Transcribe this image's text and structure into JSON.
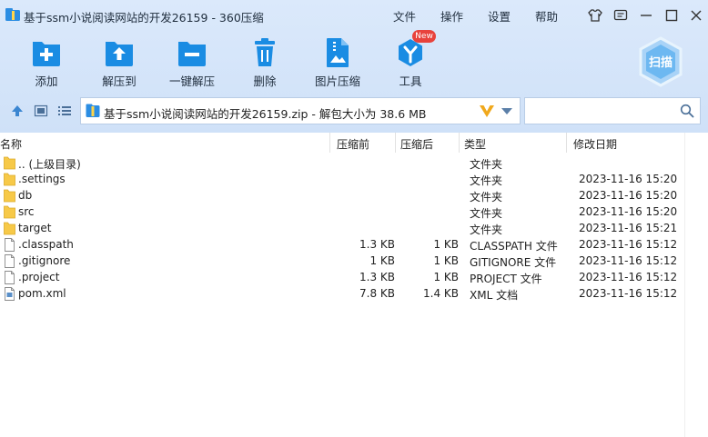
{
  "window": {
    "title": "基于ssm小说阅读网站的开发26159 - 360压缩",
    "menus": [
      "文件",
      "操作",
      "设置",
      "帮助"
    ]
  },
  "toolbar": {
    "items": [
      {
        "label": "添加",
        "icon": "add-icon"
      },
      {
        "label": "解压到",
        "icon": "extract-icon"
      },
      {
        "label": "一键解压",
        "icon": "one-click-extract-icon"
      },
      {
        "label": "删除",
        "icon": "trash-icon"
      },
      {
        "label": "图片压缩",
        "icon": "image-compress-icon"
      },
      {
        "label": "工具",
        "icon": "tools-icon"
      }
    ],
    "new_badge": "New",
    "scan_label": "扫描"
  },
  "address": {
    "path": "基于ssm小说阅读网站的开发26159.zip - 解包大小为 38.6 MB"
  },
  "search": {
    "placeholder": ""
  },
  "columns": {
    "name": "名称",
    "size": "压缩前",
    "packed": "压缩后",
    "type": "类型",
    "modified": "修改日期"
  },
  "files": [
    {
      "name": ".. (上级目录)",
      "size": "",
      "packed": "",
      "type": "文件夹",
      "modified": "",
      "icon": "folder-icon"
    },
    {
      "name": ".settings",
      "size": "",
      "packed": "",
      "type": "文件夹",
      "modified": "2023-11-16 15:20",
      "icon": "folder-icon"
    },
    {
      "name": "db",
      "size": "",
      "packed": "",
      "type": "文件夹",
      "modified": "2023-11-16 15:20",
      "icon": "folder-icon"
    },
    {
      "name": "src",
      "size": "",
      "packed": "",
      "type": "文件夹",
      "modified": "2023-11-16 15:20",
      "icon": "folder-icon"
    },
    {
      "name": "target",
      "size": "",
      "packed": "",
      "type": "文件夹",
      "modified": "2023-11-16 15:21",
      "icon": "folder-icon"
    },
    {
      "name": ".classpath",
      "size": "1.3 KB",
      "packed": "1 KB",
      "type": "CLASSPATH 文件",
      "modified": "2023-11-16 15:12",
      "icon": "file-icon"
    },
    {
      "name": ".gitignore",
      "size": "1 KB",
      "packed": "1 KB",
      "type": "GITIGNORE 文件",
      "modified": "2023-11-16 15:12",
      "icon": "file-icon"
    },
    {
      "name": ".project",
      "size": "1.3 KB",
      "packed": "1 KB",
      "type": "PROJECT 文件",
      "modified": "2023-11-16 15:12",
      "icon": "file-icon"
    },
    {
      "name": "pom.xml",
      "size": "7.8 KB",
      "packed": "1.4 KB",
      "type": "XML 文档",
      "modified": "2023-11-16 15:12",
      "icon": "xml-file-icon"
    }
  ],
  "colors": {
    "toolbar_bg": "#d4e5fa",
    "icon_blue": "#1a8ce3",
    "folder_yellow": "#f7c948",
    "badge_red": "#e8423c"
  }
}
